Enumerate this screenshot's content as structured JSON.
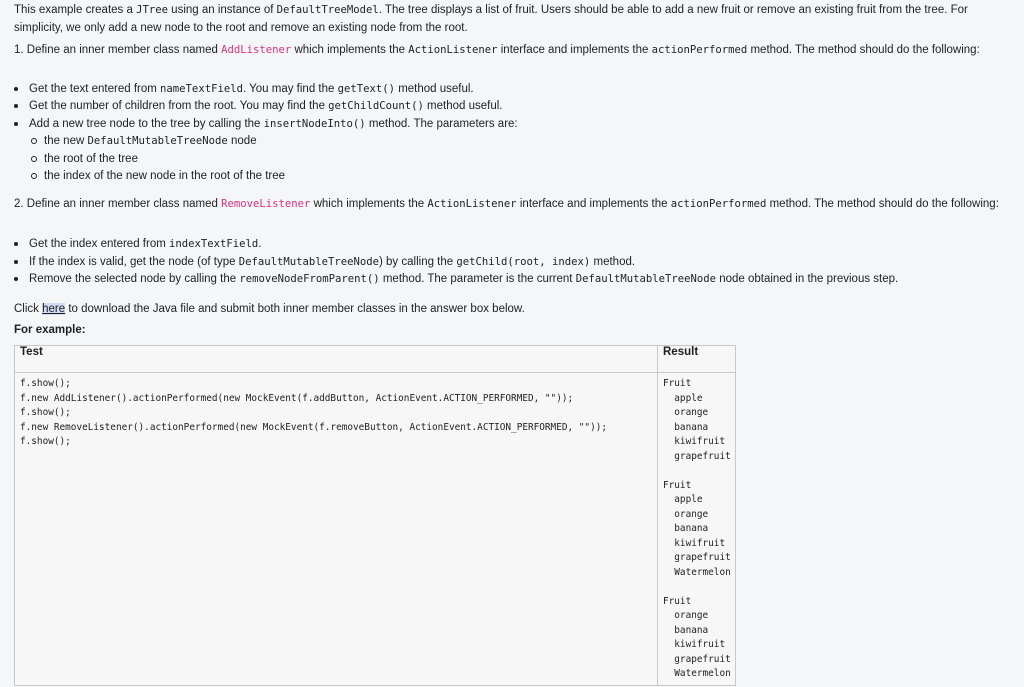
{
  "intro": {
    "s1": "This example creates a ",
    "c1": "JTree",
    "s2": " using an instance of ",
    "c2": "DefaultTreeModel",
    "s3": ". The tree displays a list of fruit. Users should be able to add a new fruit or remove an existing fruit from the tree. For simplicity, we only add a new node to the root and remove an existing node from the root."
  },
  "section1": {
    "p1": "1. Define an inner member class named ",
    "class_name": "AddListener",
    "p2": " which implements the ",
    "c_iface": "ActionListener",
    "p3": " interface and implements the ",
    "c_method": "actionPerformed",
    "p4": " method. The method should do the following:",
    "b1_a": "Get the text entered from ",
    "b1_code": "nameTextField",
    "b1_b": ". You may find the ",
    "b1_code2": "getText()",
    "b1_c": " method useful.",
    "b2_a": "Get the number of children from the root. You may find the ",
    "b2_code": "getChildCount()",
    "b2_b": " method useful.",
    "b3_a": "Add a new tree node to the tree by calling the ",
    "b3_code": "insertNodeInto()",
    "b3_b": " method. The parameters are:",
    "sub1_a": "the new ",
    "sub1_code": "DefaultMutableTreeNode",
    "sub1_b": " node",
    "sub2": "the root of the tree",
    "sub3": "the index of the new node in the root of the tree"
  },
  "section2": {
    "p1": "2. Define an inner member class named ",
    "class_name": "RemoveListener",
    "p2": " which implements the ",
    "c_iface": "ActionListener",
    "p3": " interface and implements the ",
    "c_method": "actionPerformed",
    "p4": " method. The method should do the following:",
    "b1_a": "Get the index entered from ",
    "b1_code": "indexTextField",
    "b1_b": ".",
    "b2_a": "If the index is valid, get the node (of type ",
    "b2_code": "DefaultMutableTreeNode",
    "b2_b": ") by calling the ",
    "b2_code2": "getChild(root, index)",
    "b2_c": " method.",
    "b3_a": "Remove the selected node by calling the ",
    "b3_code": "removeNodeFromParent()",
    "b3_b": " method. The parameter is the current ",
    "b3_code2": "DefaultMutableTreeNode",
    "b3_c": " node obtained in the previous step."
  },
  "click": {
    "a": "Click ",
    "link": "here",
    "b": " to download the Java file and submit both inner member classes in the answer box below."
  },
  "for_example": "For example:",
  "table": {
    "header_test": "Test",
    "header_result": "Result",
    "test_code": "f.show();\nf.new AddListener().actionPerformed(new MockEvent(f.addButton, ActionEvent.ACTION_PERFORMED, \"\"));\nf.show();\nf.new RemoveListener().actionPerformed(new MockEvent(f.removeButton, ActionEvent.ACTION_PERFORMED, \"\"));\nf.show();",
    "result": "Fruit\n  apple\n  orange\n  banana\n  kiwifruit\n  grapefruit\n\nFruit\n  apple\n  orange\n  banana\n  kiwifruit\n  grapefruit\n  Watermelon\n\nFruit\n  orange\n  banana\n  kiwifruit\n  grapefruit\n  Watermelon"
  }
}
